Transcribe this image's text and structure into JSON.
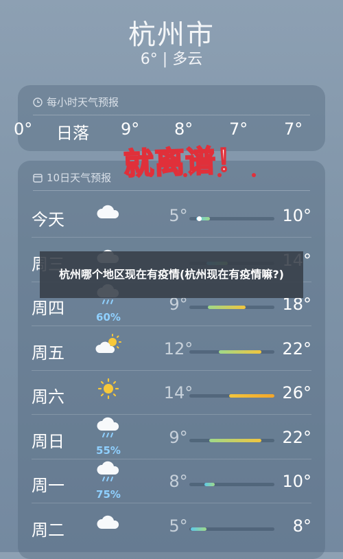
{
  "location": {
    "city": "杭州市",
    "summary": "6° | 多云"
  },
  "hourly": {
    "header": "每小时天气预报",
    "items": [
      "0°",
      "日落",
      "9°",
      "8°",
      "7°",
      "7°"
    ]
  },
  "daily": {
    "header": "10日天气预报",
    "days": [
      {
        "name": "今天",
        "icon": "cloud-icon",
        "low": "5°",
        "high": "10°",
        "precip": "",
        "bar": {
          "start": 0.08,
          "end": 0.24
        },
        "current": 0.09
      },
      {
        "name": "周三",
        "icon": "cloud-icon",
        "low": "",
        "high": "14°",
        "precip": "",
        "bar": {
          "start": 0.2,
          "end": 0.45
        }
      },
      {
        "name": "周四",
        "icon": "rain-icon",
        "low": "9°",
        "high": "18°",
        "precip": "60%",
        "bar": {
          "start": 0.22,
          "end": 0.66
        }
      },
      {
        "name": "周五",
        "icon": "partly-sunny-icon",
        "low": "12°",
        "high": "22°",
        "precip": "",
        "bar": {
          "start": 0.35,
          "end": 0.85
        }
      },
      {
        "name": "周六",
        "icon": "sun-icon",
        "low": "14°",
        "high": "26°",
        "precip": "",
        "bar": {
          "start": 0.47,
          "end": 1.0
        }
      },
      {
        "name": "周日",
        "icon": "rain-icon",
        "low": "9°",
        "high": "22°",
        "precip": "55%",
        "bar": {
          "start": 0.23,
          "end": 0.85
        }
      },
      {
        "name": "周一",
        "icon": "rain-icon",
        "low": "8°",
        "high": "10°",
        "precip": "75%",
        "bar": {
          "start": 0.18,
          "end": 0.3
        }
      },
      {
        "name": "周二",
        "icon": "cloud-icon",
        "low": "5°",
        "high": "8°",
        "precip": "",
        "bar": {
          "start": 0.02,
          "end": 0.2
        }
      }
    ]
  },
  "overlay": {
    "sticker": "就离谱！",
    "banner": "杭州哪个地区现在有疫情(杭州现在有疫情嘛?)"
  },
  "colors": {
    "bar_cool": "#5ec8e8",
    "bar_mid": "#9ed98a",
    "bar_warm": "#f2c53d",
    "bar_hot": "#f3a62a"
  }
}
